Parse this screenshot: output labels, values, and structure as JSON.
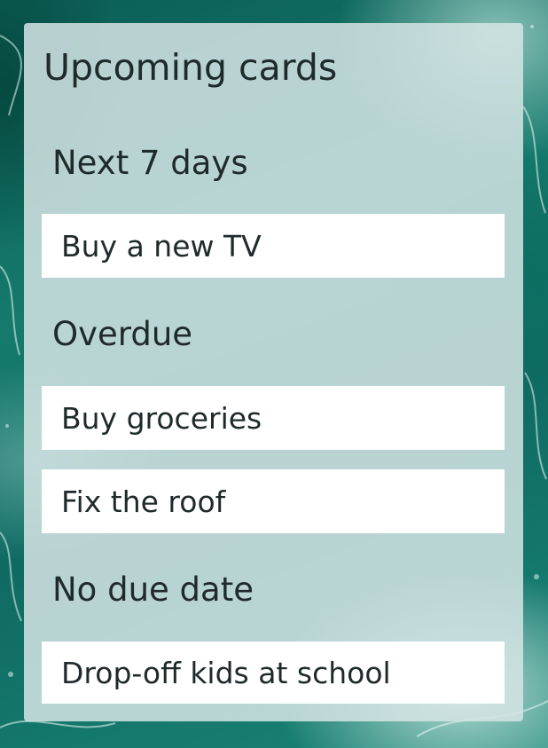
{
  "widget": {
    "title": "Upcoming cards"
  },
  "sections": [
    {
      "heading": "Next 7 days",
      "cards": [
        "Buy a new TV"
      ]
    },
    {
      "heading": "Overdue",
      "cards": [
        "Buy groceries",
        "Fix the roof"
      ]
    },
    {
      "heading": "No due date",
      "cards": [
        "Drop-off kids at school"
      ]
    }
  ],
  "colors": {
    "card_background": "#ffffff",
    "widget_background": "#d4e4e4",
    "text": "#1f2a2a",
    "wallpaper_accent": "#157a6c"
  }
}
